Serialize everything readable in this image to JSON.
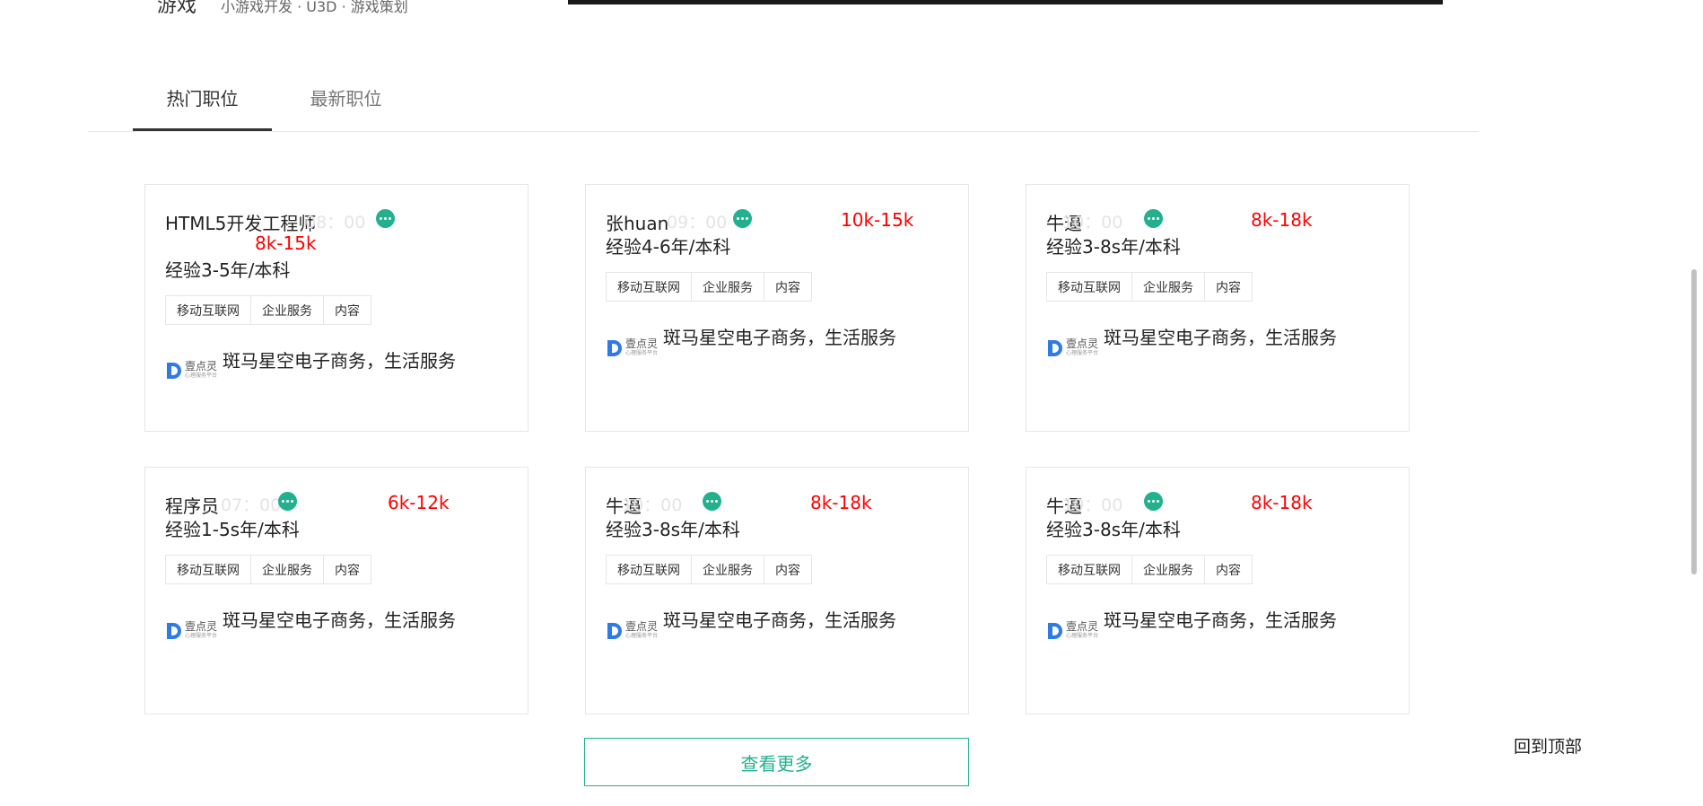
{
  "top": {
    "category": "游戏",
    "sub_items": "小游戏开发 · U3D · 游戏策划"
  },
  "tabs": [
    {
      "label": "热门职位",
      "active": true
    },
    {
      "label": "最新职位",
      "active": false
    }
  ],
  "jobs": [
    {
      "title": "HTML5开发工程师",
      "time": "08：00",
      "salary": "8k-15k",
      "requirement": "经验3-5年/本科",
      "tags": [
        "移动互联网",
        "企业服务",
        "内容"
      ],
      "logo_text": "壹点灵",
      "logo_sub": "心理服务平台",
      "company": "斑马星空电子商务，生活服务"
    },
    {
      "title": "张huan",
      "time": "09：00",
      "salary": "10k-15k",
      "requirement": "经验4-6年/本科",
      "tags": [
        "移动互联网",
        "企业服务",
        "内容"
      ],
      "logo_text": "壹点灵",
      "logo_sub": "心理服务平台",
      "company": "斑马星空电子商务，生活服务"
    },
    {
      "title": "牛逼",
      "time": "10：00",
      "salary": "8k-18k",
      "requirement": "经验3-8s年/本科",
      "tags": [
        "移动互联网",
        "企业服务",
        "内容"
      ],
      "logo_text": "壹点灵",
      "logo_sub": "心理服务平台",
      "company": "斑马星空电子商务，生活服务"
    },
    {
      "title": "程序员",
      "time": "07：00",
      "salary": "6k-12k",
      "requirement": "经验1-5s年/本科",
      "tags": [
        "移动互联网",
        "企业服务",
        "内容"
      ],
      "logo_text": "壹点灵",
      "logo_sub": "心理服务平台",
      "company": "斑马星空电子商务，生活服务"
    },
    {
      "title": "牛逼",
      "time": "10：00",
      "salary": "8k-18k",
      "requirement": "经验3-8s年/本科",
      "tags": [
        "移动互联网",
        "企业服务",
        "内容"
      ],
      "logo_text": "壹点灵",
      "logo_sub": "心理服务平台",
      "company": "斑马星空电子商务，生活服务"
    },
    {
      "title": "牛逼",
      "time": "10：00",
      "salary": "8k-18k",
      "requirement": "经验3-8s年/本科",
      "tags": [
        "移动互联网",
        "企业服务",
        "内容"
      ],
      "logo_text": "壹点灵",
      "logo_sub": "心理服务平台",
      "company": "斑马星空电子商务，生活服务"
    }
  ],
  "more_button": "查看更多",
  "back_to_top": "回到顶部",
  "colors": {
    "accent": "#23b08f",
    "salary": "#ff0000",
    "logo": "#2f7be6"
  },
  "icons": {
    "chat": "chat-bubble-icon",
    "logo": "company-logo"
  }
}
